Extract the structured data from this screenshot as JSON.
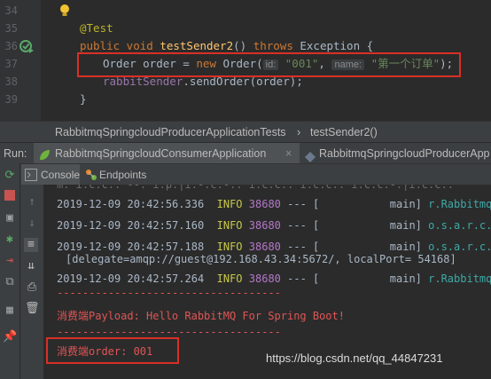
{
  "editor": {
    "lines": [
      {
        "num": "34"
      },
      {
        "num": "35"
      },
      {
        "num": "36"
      },
      {
        "num": "37"
      },
      {
        "num": "38"
      },
      {
        "num": "39"
      }
    ],
    "annotation": "@Test",
    "sig_kw1": "public void ",
    "sig_method": "testSender2",
    "sig_mid": "() ",
    "sig_kw2": "throws ",
    "sig_rest": "Exception {",
    "l37_type": "Order order = ",
    "l37_new": "new ",
    "l37_ctor": "Order(",
    "l37_hint1": "id:",
    "l37_val1": "\"001\"",
    "l37_comma": ", ",
    "l37_hint2": "name:",
    "l37_val2": "\"第一个订单\"",
    "l37_end": ");",
    "l38_field": "rabbitSender",
    "l38_rest": ".sendOrder(order);",
    "l39": "}"
  },
  "breadcrumb": {
    "class": "RabbitmqSpringcloudProducerApplicationTests",
    "sep": "›",
    "method": "testSender2()"
  },
  "run": {
    "label": "Run:",
    "tabs": [
      {
        "label": "RabbitmqSpringcloudConsumerApplication"
      },
      {
        "label": "RabbitmqSpringcloudProducerApp"
      }
    ],
    "close": "×"
  },
  "console_bar": {
    "console_label": "Console",
    "endpoints_label": "Endpoints"
  },
  "console": {
    "top_cut": "m: i.c.c.: --: i.p.|i.-.c.-.: i.c.c.: i.c.c.: i.c.c.-.|i.c.c.:",
    "logs": [
      {
        "ts": "2019-12-09 20:42:56.336",
        "level": "INFO",
        "pid": "38680",
        "sep": "---",
        "bracket": "[",
        "thread": "main]",
        "logger": "r.RabbitmqSpri"
      },
      {
        "ts": "2019-12-09 20:42:57.160",
        "level": "INFO",
        "pid": "38680",
        "sep": "---",
        "bracket": "[",
        "thread": "main]",
        "logger": "o.s.a.r.c.Cach"
      },
      {
        "ts": "2019-12-09 20:42:57.188",
        "level": "INFO",
        "pid": "38680",
        "sep": "---",
        "bracket": "[",
        "thread": "main]",
        "logger": "o.s.a.r.c.Cach"
      }
    ],
    "delegate": "[delegate=amqp://guest@192.168.43.34:5672/, localPort= 54168]",
    "log4": {
      "ts": "2019-12-09 20:42:57.264",
      "level": "INFO",
      "pid": "38680",
      "sep": "---",
      "bracket": "[",
      "thread": "main]",
      "logger": "r.RabbitmqSpri"
    },
    "divider": "-----------------------------------",
    "payload": "消费端Payload: Hello RabbitMQ For Spring Boot!",
    "divider2": "-----------------------------------",
    "order": "消费端order: 001"
  },
  "watermark": "https://blog.csdn.net/qq_44847231",
  "colors": {
    "accent_red": "#d93025",
    "bg": "#2b2b2b",
    "panel": "#3c3f41"
  }
}
